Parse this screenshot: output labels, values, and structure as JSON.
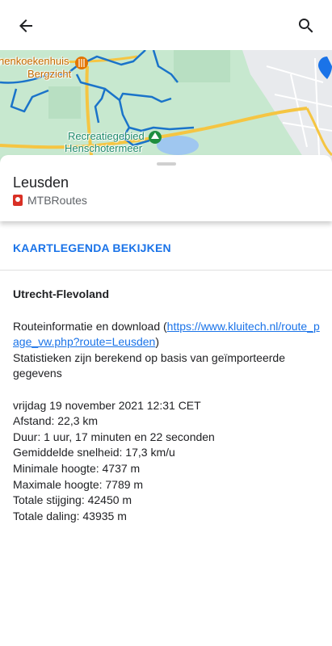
{
  "header": {
    "back_icon": "arrow-back-icon",
    "search_icon": "search-icon"
  },
  "map": {
    "labels": {
      "poi_line1": "nenkoekenhuis",
      "poi_line2": "Bergzicht",
      "rec_line1": "Recreatiegebied",
      "rec_line2": "Henschotermeer"
    },
    "colors": {
      "land": "#c7e8cf",
      "route": "#1a73c9",
      "road": "#f5c542",
      "urban": "#e8eaed",
      "water": "#9fc7f0"
    }
  },
  "place": {
    "title": "Leusden",
    "source": "MTBRoutes"
  },
  "legend_link": "KAARTLEGENDA BEKIJKEN",
  "details": {
    "section_title": "Utrecht-Flevoland",
    "route_info_prefix": "Routeinformatie en download (",
    "route_url": "https://www.kluitech.nl/route_page_vw.php?route=Leusden",
    "route_info_suffix": ")",
    "stats_note": "Statistieken zijn berekend op basis van geïmporteerde gegevens",
    "date": "vrijdag 19 november 2021 12:31 CET",
    "distance": "Afstand: 22,3 km",
    "duration": "Duur: 1 uur, 17 minuten en 22 seconden",
    "avg_speed": "Gemiddelde snelheid: 17,3 km/u",
    "min_height": "Minimale hoogte: 4737 m",
    "max_height": "Maximale hoogte: 7789 m",
    "total_ascent": "Totale stijging: 42450 m",
    "total_descent": "Totale daling: 43935 m"
  }
}
